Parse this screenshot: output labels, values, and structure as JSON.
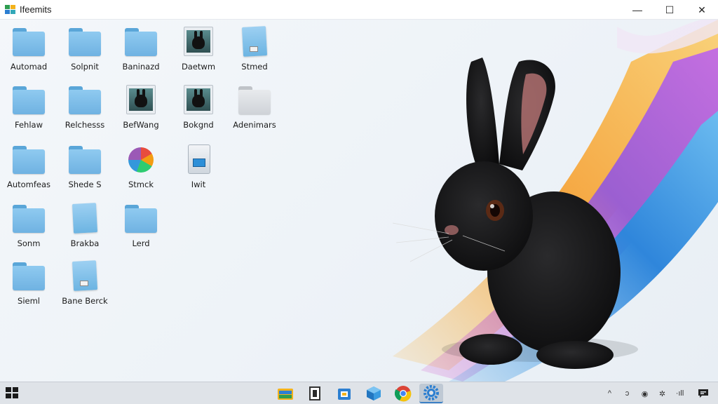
{
  "window": {
    "title": "Ifeemits",
    "minimize_symbol": "—",
    "maximize_symbol": "☐",
    "close_symbol": "✕"
  },
  "desktop": {
    "icons": [
      {
        "label": "Automad",
        "kind": "folder"
      },
      {
        "label": "Solpnit",
        "kind": "folder"
      },
      {
        "label": "Baninazd",
        "kind": "folder"
      },
      {
        "label": "Daetwm",
        "kind": "picture"
      },
      {
        "label": "Stmed",
        "kind": "document"
      },
      {
        "label": "Fehlaw",
        "kind": "folder"
      },
      {
        "label": "Relchesss",
        "kind": "folder"
      },
      {
        "label": "BefWang",
        "kind": "picture"
      },
      {
        "label": "Bokgnd",
        "kind": "picture"
      },
      {
        "label": "Adenimars",
        "kind": "folder-grey"
      },
      {
        "label": "Automfeas",
        "kind": "folder"
      },
      {
        "label": "Shede S",
        "kind": "folder"
      },
      {
        "label": "Stmck",
        "kind": "color-wheel"
      },
      {
        "label": "Iwit",
        "kind": "app"
      },
      {
        "label": "Sonm",
        "kind": "folder"
      },
      {
        "label": "Brakba",
        "kind": "document-plain"
      },
      {
        "label": "Lerd",
        "kind": "folder"
      },
      {
        "label": "Sieml",
        "kind": "folder"
      },
      {
        "label": "Bane Berck",
        "kind": "document"
      }
    ]
  },
  "taskbar": {
    "apps": [
      "file-explorer-icon",
      "notepad-icon",
      "store-icon",
      "3d-cube-icon",
      "chrome-icon",
      "settings-gear-icon"
    ],
    "active_app": "settings-gear-icon",
    "tray": {
      "chevron": "^",
      "item1": "ↄ",
      "item2": "◉",
      "item3": "✲",
      "item4": "·ıll",
      "notification": "▪"
    }
  },
  "colors": {
    "folder": "#6fb2e2",
    "taskbar": "#dfe3e8",
    "accent": "#3b7fc4"
  }
}
